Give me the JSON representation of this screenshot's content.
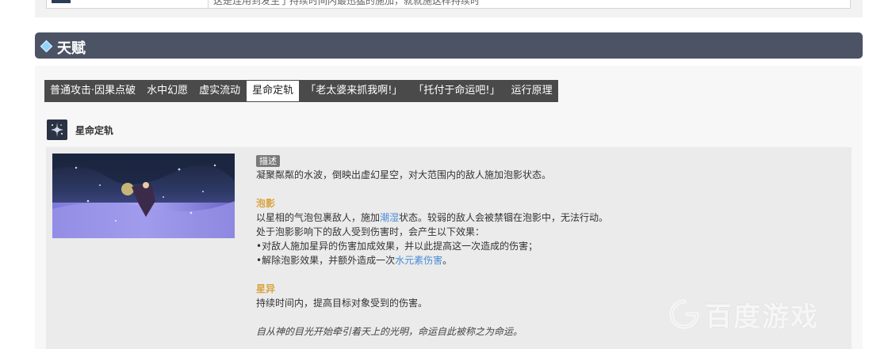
{
  "top_row": {
    "text": "这是连用到发生了持续时间内最迅猛的施加，就就施这样持续时"
  },
  "section": {
    "title": "天赋"
  },
  "tabs": [
    {
      "label": "普通攻击·因果点破"
    },
    {
      "label": "水中幻愿"
    },
    {
      "label": "虚实流动"
    },
    {
      "label": "星命定轨"
    },
    {
      "label": "「老太婆来抓我啊!」"
    },
    {
      "label": "「托付于命运吧!」"
    },
    {
      "label": "运行原理"
    }
  ],
  "active_tab_index": 3,
  "talent": {
    "name": "星命定轨",
    "description_badge": "描述",
    "intro": "凝聚粼粼的水波，倒映出虚幻星空，对大范围内的敌人施加泡影状态。",
    "bubble": {
      "heading": "泡影",
      "line1_a": "以星相的气泡包裹敌人，施加",
      "line1_link": "潮湿",
      "line1_b": "状态。较弱的敌人会被禁锢在泡影中，无法行动。",
      "line2": "处于泡影影响下的敌人受到伤害时，会产生以下效果：",
      "line3": "•对敌人施加星异的伤害加成效果，并以此提高这一次造成的伤害；",
      "line4_a": "•解除泡影效果，并额外造成一次",
      "line4_link": "水元素伤害",
      "line4_b": "。"
    },
    "star": {
      "heading": "星异",
      "line1": "持续时间内，提高目标对象受到的伤害。"
    },
    "quote": "自从神的目光开始牵引着天上的光明，命运自此被称之为命运。"
  },
  "watermark": {
    "text": "百度游戏"
  },
  "colors": {
    "header_bg": "#4c5364",
    "tab_bg": "#4a4a4a",
    "heading_gold": "#d9a441",
    "link_blue": "#4a8bd6"
  }
}
